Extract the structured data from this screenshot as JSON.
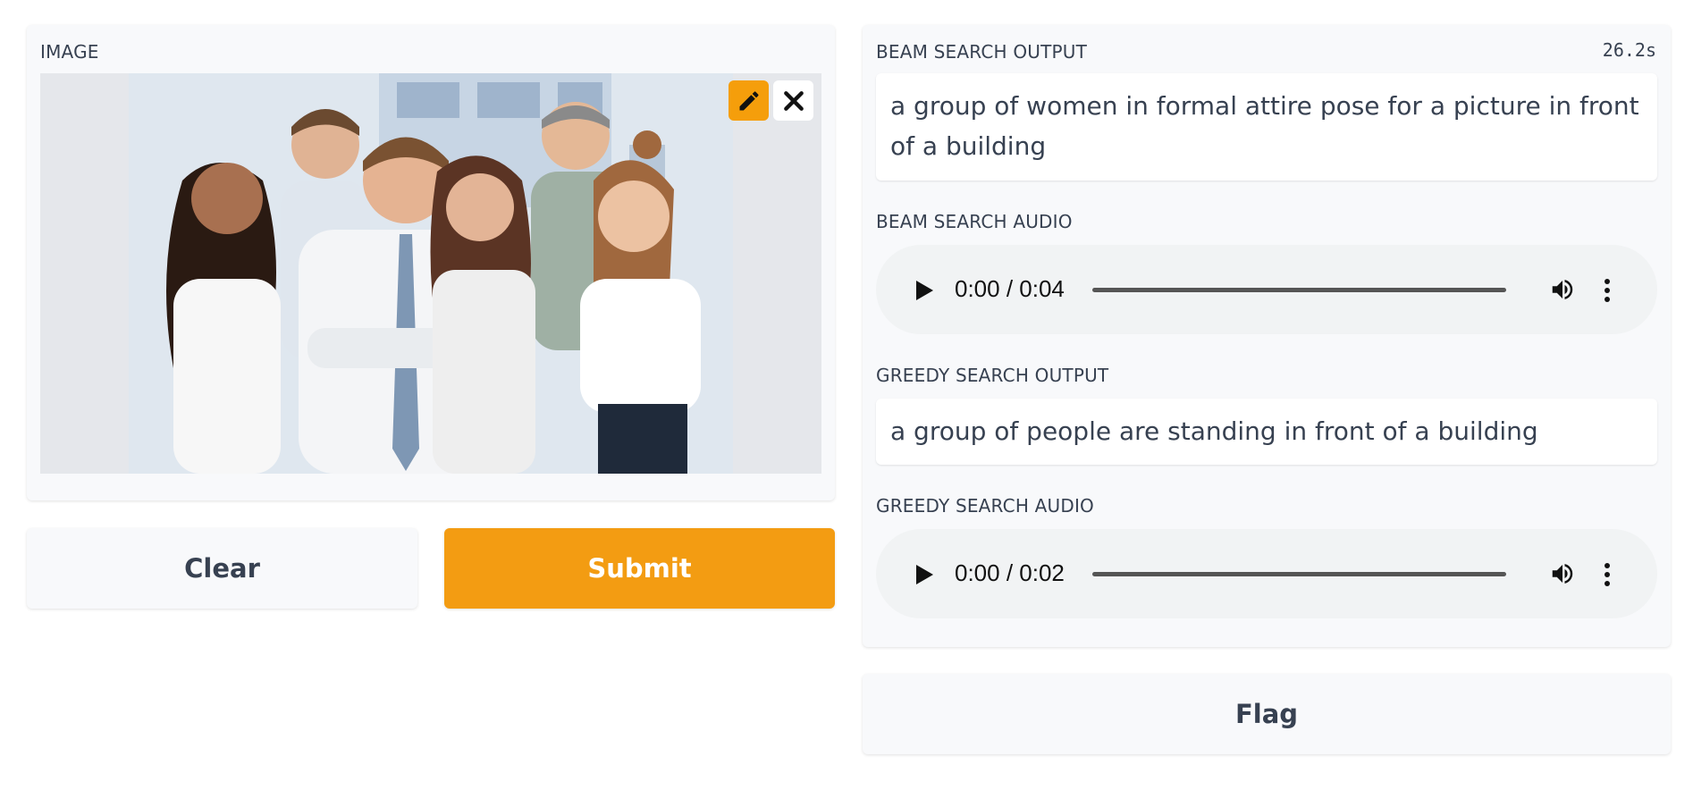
{
  "input": {
    "image_label": "IMAGE",
    "edit_icon": "pencil-icon",
    "close_icon": "close-icon"
  },
  "buttons": {
    "clear": "Clear",
    "submit": "Submit",
    "flag": "Flag"
  },
  "output": {
    "timer": "26.2s",
    "beam_label": "BEAM SEARCH OUTPUT",
    "beam_text": "a group of women in formal attire pose for a picture in front of a building",
    "beam_audio_label": "BEAM SEARCH AUDIO",
    "beam_audio_time": "0:00 / 0:04",
    "greedy_label": "GREEDY SEARCH OUTPUT",
    "greedy_text": "a group of people are standing in front of a building",
    "greedy_audio_label": "GREEDY SEARCH AUDIO",
    "greedy_audio_time": "0:00 / 0:02"
  },
  "colors": {
    "accent": "#f39c12",
    "panel_bg": "#f8f9fb",
    "text": "#374151"
  }
}
